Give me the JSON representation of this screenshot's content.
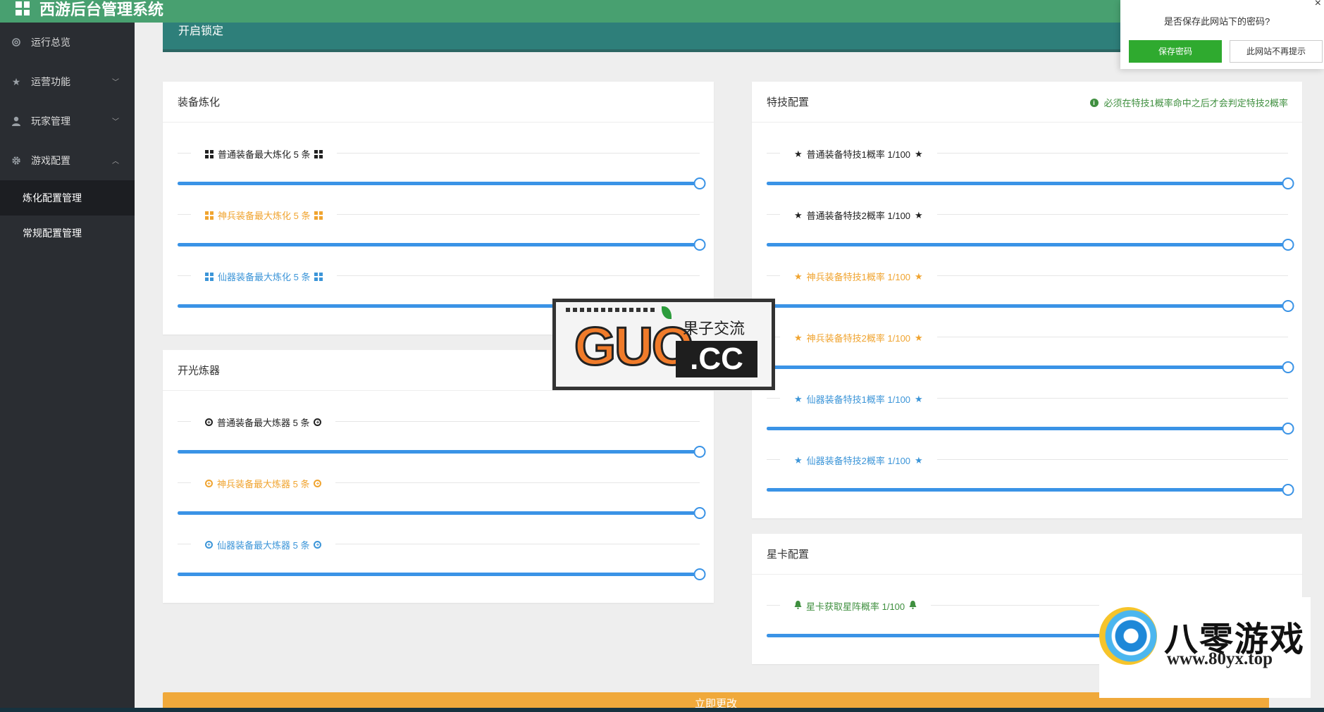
{
  "app": {
    "title": "西游后台管理系统"
  },
  "sidebar": {
    "items": [
      {
        "label": "运行总览",
        "icon": "gear-icon",
        "has_caret": false
      },
      {
        "label": "运营功能",
        "icon": "star-icon",
        "has_caret": true,
        "caret": "﹀"
      },
      {
        "label": "玩家管理",
        "icon": "user-icon",
        "has_caret": true,
        "caret": "﹀"
      },
      {
        "label": "游戏配置",
        "icon": "cog-icon",
        "has_caret": true,
        "caret": "︿"
      }
    ],
    "subitems": [
      {
        "label": "炼化配置管理",
        "active": true
      },
      {
        "label": "常规配置管理",
        "active": false
      }
    ]
  },
  "lockbar": {
    "label": "开启锁定"
  },
  "panels": {
    "refine": {
      "title": "装备炼化",
      "rows": [
        {
          "label": "普通装备最大炼化 5 条",
          "tone": "black",
          "value": 1.0
        },
        {
          "label": "神兵装备最大炼化 5 条",
          "tone": "orange",
          "value": 1.0
        },
        {
          "label": "仙器装备最大炼化 5 条",
          "tone": "blue",
          "value": 1.0
        }
      ]
    },
    "forge": {
      "title": "开光炼器",
      "rows": [
        {
          "label": "普通装备最大炼器 5 条",
          "tone": "black",
          "value": 1.0
        },
        {
          "label": "神兵装备最大炼器 5 条",
          "tone": "orange",
          "value": 1.0
        },
        {
          "label": "仙器装备最大炼器 5 条",
          "tone": "blue",
          "value": 1.0
        }
      ]
    },
    "skills": {
      "title": "特技配置",
      "tip": "必须在特技1概率命中之后才会判定特技2概率",
      "rows": [
        {
          "label": "普通装备特技1概率 1/100",
          "tone": "black",
          "value": 1.0
        },
        {
          "label": "普通装备特技2概率 1/100",
          "tone": "black",
          "value": 1.0
        },
        {
          "label": "神兵装备特技1概率 1/100",
          "tone": "orange",
          "value": 1.0
        },
        {
          "label": "神兵装备特技2概率 1/100",
          "tone": "orange",
          "value": 1.0
        },
        {
          "label": "仙器装备特技1概率 1/100",
          "tone": "blue",
          "value": 1.0
        },
        {
          "label": "仙器装备特技2概率 1/100",
          "tone": "blue",
          "value": 1.0
        }
      ]
    },
    "starcard": {
      "title": "星卡配置",
      "rows": [
        {
          "label": "星卡获取星阵概率 1/100",
          "tone": "green",
          "value": 1.0
        }
      ]
    }
  },
  "submit": {
    "label": "立即更改"
  },
  "password_popup": {
    "title": "是否保存此网站下的密码?",
    "save_label": "保存密码",
    "never_label": "此网站不再提示",
    "close": "×"
  },
  "watermarks": {
    "guo": {
      "big": "GUO",
      "cc": ".CC",
      "cn": "果子交流"
    },
    "yx": {
      "name": "八零游戏",
      "url": "www.80yx.top"
    }
  },
  "colors": {
    "header": "#48a070",
    "sidebar": "#2a2d32",
    "lockbar": "#2e7f7a",
    "slider": "#3a93e6",
    "orange": "#f0a430",
    "blue": "#3c95d8",
    "green": "#3f8f3f",
    "submit": "#f0a93b"
  }
}
